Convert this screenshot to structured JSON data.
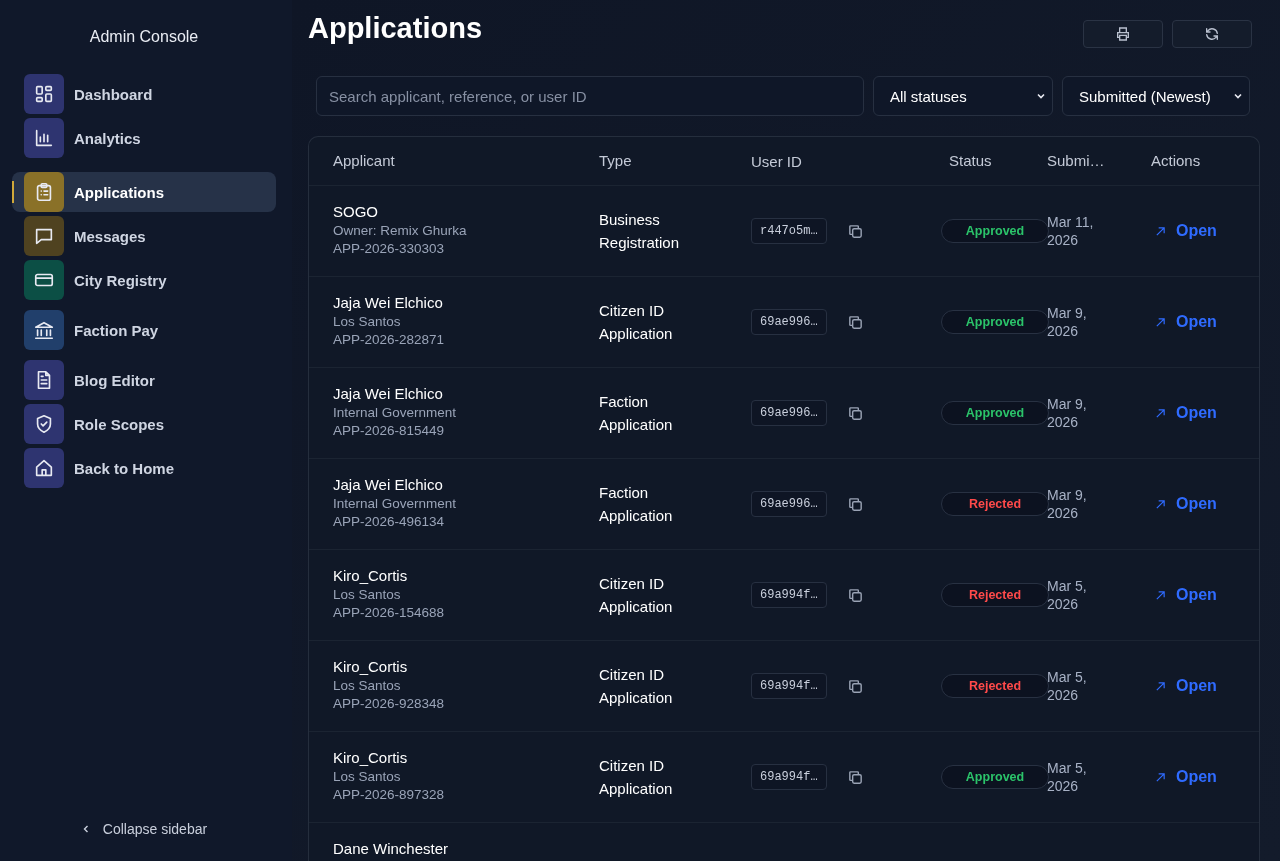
{
  "sidebar": {
    "title": "Admin Console",
    "groups": [
      [
        {
          "label": "Dashboard",
          "color": "#2e3470",
          "selected": false
        },
        {
          "label": "Analytics",
          "color": "#2e3470",
          "selected": false
        }
      ],
      [
        {
          "label": "Applications",
          "color": "#8a7128",
          "selected": true
        },
        {
          "label": "Messages",
          "color": "#4f4220",
          "selected": false
        },
        {
          "label": "City Registry",
          "color": "#0c4f45",
          "selected": false
        }
      ],
      [
        {
          "label": "Faction Pay",
          "color": "#213f6b",
          "selected": false
        }
      ],
      [
        {
          "label": "Blog Editor",
          "color": "#2e3470",
          "selected": false
        },
        {
          "label": "Role Scopes",
          "color": "#2e3470",
          "selected": false
        },
        {
          "label": "Back to Home",
          "color": "#2e3470",
          "selected": false
        }
      ]
    ],
    "collapse": "Collapse sidebar"
  },
  "page": {
    "title": "Applications"
  },
  "filters": {
    "search_placeholder": "Search applicant, reference, or user ID",
    "status": "All statuses",
    "sort": "Submitted (Newest)"
  },
  "table": {
    "columns": [
      "Applicant",
      "Type",
      "User ID",
      "Status",
      "Submi…",
      "Actions"
    ],
    "rows": [
      {
        "name": "SOGO",
        "detail": "Owner: Remix Ghurka",
        "reference": "APP-2026-330303",
        "type": "Business Registration",
        "user_id": "r447o5m…",
        "status": "Approved",
        "color": "#2bc46a",
        "submitted": "Mar 11, 2026",
        "action": "Open"
      },
      {
        "name": "Jaja Wei Elchico",
        "detail": "Los Santos",
        "reference": "APP-2026-282871",
        "type": "Citizen ID Application",
        "user_id": "69ae996…",
        "status": "Approved",
        "color": "#2bc46a",
        "submitted": "Mar 9, 2026",
        "action": "Open"
      },
      {
        "name": "Jaja Wei Elchico",
        "detail": "Internal Government",
        "reference": "APP-2026-815449",
        "type": "Faction Application",
        "user_id": "69ae996…",
        "status": "Approved",
        "color": "#2bc46a",
        "submitted": "Mar 9, 2026",
        "action": "Open"
      },
      {
        "name": "Jaja Wei Elchico",
        "detail": "Internal Government",
        "reference": "APP-2026-496134",
        "type": "Faction Application",
        "user_id": "69ae996…",
        "status": "Rejected",
        "color": "#ff4a4a",
        "submitted": "Mar 9, 2026",
        "action": "Open"
      },
      {
        "name": "Kiro_Cortis",
        "detail": "Los Santos",
        "reference": "APP-2026-154688",
        "type": "Citizen ID Application",
        "user_id": "69a994f…",
        "status": "Rejected",
        "color": "#ff4a4a",
        "submitted": "Mar 5, 2026",
        "action": "Open"
      },
      {
        "name": "Kiro_Cortis",
        "detail": "Los Santos",
        "reference": "APP-2026-928348",
        "type": "Citizen ID Application",
        "user_id": "69a994f…",
        "status": "Rejected",
        "color": "#ff4a4a",
        "submitted": "Mar 5, 2026",
        "action": "Open"
      },
      {
        "name": "Kiro_Cortis",
        "detail": "Los Santos",
        "reference": "APP-2026-897328",
        "type": "Citizen ID Application",
        "user_id": "69a994f…",
        "status": "Approved",
        "color": "#2bc46a",
        "submitted": "Mar 5, 2026",
        "action": "Open"
      },
      {
        "name": "Dane Winchester"
      }
    ]
  }
}
